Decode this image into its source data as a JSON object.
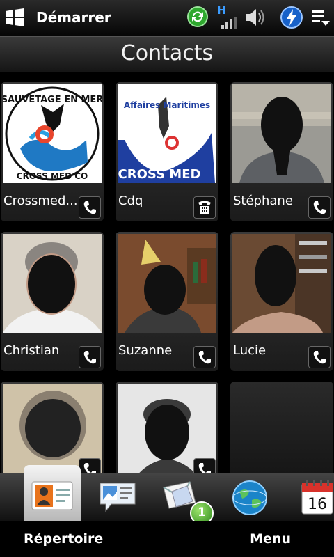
{
  "status": {
    "app_title": "Démarrer",
    "network_label": "H",
    "icons": [
      "windows-flag-icon",
      "sync-icon",
      "signal-icon",
      "volume-icon",
      "power-icon",
      "menu-dropdown-icon"
    ]
  },
  "header": {
    "title": "Contacts"
  },
  "contacts": [
    {
      "name": "Crossmed..."
    },
    {
      "name": "Cdq"
    },
    {
      "name": "Stéphane"
    },
    {
      "name": "Christian"
    },
    {
      "name": "Suzanne"
    },
    {
      "name": "Lucie"
    }
  ],
  "logos": {
    "crossmed_top": "SAUVETAGE EN MER",
    "crossmed_bottom": "CROSS MED CO",
    "cdq_top": "Affaires Maritimes",
    "cdq_bottom": "CROSS MED"
  },
  "tabbar": {
    "mail_badge": "1",
    "calendar_day": "16",
    "icons": [
      "contacts-card-icon",
      "photo-messages-icon",
      "mail-icon",
      "internet-globe-icon",
      "calendar-icon"
    ]
  },
  "softkeys": {
    "left": "Répertoire",
    "right": "Menu"
  }
}
